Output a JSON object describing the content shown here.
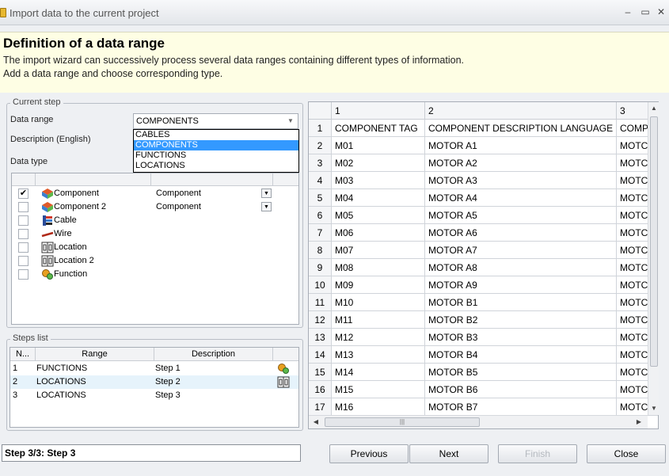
{
  "window": {
    "title": "Import data to the current project",
    "minimize_glyph": "–",
    "maximize_glyph": "▭",
    "close_glyph": "✕"
  },
  "header": {
    "title": "Definition of a data range",
    "line1": "The import wizard can successively process several data ranges containing different types of information.",
    "line2": "Add a data range and choose corresponding type."
  },
  "current_step": {
    "group_label": "Current step",
    "data_range_label": "Data range",
    "data_range_value": "COMPONENTS",
    "description_label": "Description (English)",
    "data_type_label": "Data type",
    "dropdown_options": [
      "CABLES",
      "COMPONENTS",
      "FUNCTIONS",
      "LOCATIONS"
    ],
    "selected_option": "COMPONENTS",
    "data_types": [
      {
        "name": "Component",
        "checked": true,
        "value": "Component",
        "icon": "component-icon"
      },
      {
        "name": "Component 2",
        "checked": false,
        "value": "Component",
        "icon": "component-icon"
      },
      {
        "name": "Cable",
        "checked": false,
        "value": "",
        "icon": "cable-icon"
      },
      {
        "name": "Wire",
        "checked": false,
        "value": "",
        "icon": "wire-icon"
      },
      {
        "name": "Location",
        "checked": false,
        "value": "",
        "icon": "location-icon"
      },
      {
        "name": "Location 2",
        "checked": false,
        "value": "",
        "icon": "location-icon"
      },
      {
        "name": "Function",
        "checked": false,
        "value": "",
        "icon": "function-icon"
      }
    ]
  },
  "steps_list": {
    "group_label": "Steps list",
    "columns": [
      "N...",
      "Range",
      "Description"
    ],
    "rows": [
      {
        "n": "1",
        "range": "FUNCTIONS",
        "description": "Step 1",
        "icon": "function-icon"
      },
      {
        "n": "2",
        "range": "LOCATIONS",
        "description": "Step 2",
        "icon": "location-icon"
      },
      {
        "n": "3",
        "range": "LOCATIONS",
        "description": "Step 3",
        "icon": ""
      }
    ]
  },
  "grid": {
    "columns": [
      "1",
      "2",
      "3"
    ],
    "rows": [
      [
        "1",
        "COMPONENT TAG",
        "COMPONENT DESCRIPTION LANGUAGE 1",
        "COMP"
      ],
      [
        "2",
        "M01",
        "MOTOR A1",
        "MOTC"
      ],
      [
        "3",
        "M02",
        "MOTOR A2",
        "MOTC"
      ],
      [
        "4",
        "M03",
        "MOTOR A3",
        "MOTC"
      ],
      [
        "5",
        "M04",
        "MOTOR A4",
        "MOTC"
      ],
      [
        "6",
        "M05",
        "MOTOR A5",
        "MOTC"
      ],
      [
        "7",
        "M06",
        "MOTOR A6",
        "MOTC"
      ],
      [
        "8",
        "M07",
        "MOTOR A7",
        "MOTC"
      ],
      [
        "9",
        "M08",
        "MOTOR A8",
        "MOTC"
      ],
      [
        "10",
        "M09",
        "MOTOR A9",
        "MOTC"
      ],
      [
        "11",
        "M10",
        "MOTOR B1",
        "MOTC"
      ],
      [
        "12",
        "M11",
        "MOTOR B2",
        "MOTC"
      ],
      [
        "13",
        "M12",
        "MOTOR B3",
        "MOTC"
      ],
      [
        "14",
        "M13",
        "MOTOR B4",
        "MOTC"
      ],
      [
        "15",
        "M14",
        "MOTOR B5",
        "MOTC"
      ],
      [
        "16",
        "M15",
        "MOTOR B6",
        "MOTC"
      ],
      [
        "17",
        "M16",
        "MOTOR B7",
        "MOTC"
      ]
    ]
  },
  "status": "Step 3/3: Step 3",
  "buttons": {
    "previous": "Previous",
    "next": "Next",
    "finish": "Finish",
    "close": "Close"
  },
  "colors": {
    "header_bg": "#fefee4",
    "selection": "#3399ff",
    "step_selected_bg": "#e6f3fb"
  }
}
